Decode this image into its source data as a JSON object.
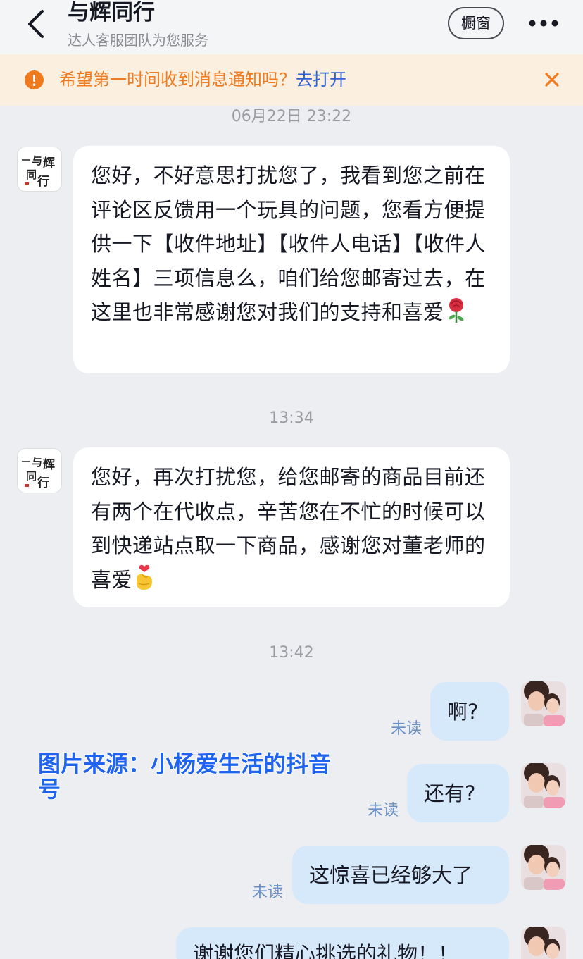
{
  "header": {
    "title": "与辉同行",
    "subtitle": "达人客服团队为您服务",
    "window_button": "橱窗"
  },
  "notice": {
    "text": "希望第一时间收到消息通知吗？",
    "link": "去打开"
  },
  "timestamps": [
    "06月22日 23:22",
    "13:34",
    "13:42"
  ],
  "brand_avatar_text": "与辉同行",
  "messages_in": [
    {
      "text": "您好，不好意思打扰您了，我看到您之前在评论区反馈用一个玩具的问题，您看方便提供一下【收件地址】【收件人电话】【收件人姓名】三项信息么，咱们给您邮寄过去，在这里也非常感谢您对我们的支持和喜爱",
      "emoji": "rose-icon"
    },
    {
      "text": "您好，再次打扰您，给您邮寄的商品目前还有两个在代收点，辛苦您在不忙的时候可以到快递站点取一下商品，感谢您对董老师的喜爱",
      "emoji": "finger-heart-icon"
    }
  ],
  "messages_out": [
    {
      "text": "啊?",
      "status": "未读"
    },
    {
      "text": "还有?",
      "status": "未读"
    },
    {
      "text": "这惊喜已经够大了",
      "status": "未读"
    },
    {
      "text": "谢谢您们精心挑选的礼物！！",
      "status": ""
    }
  ],
  "watermark": "图片来源：小杨爱生活的抖音号",
  "colors": {
    "accent_orange": "#f07a1e",
    "link_blue": "#2c60d8",
    "outgoing_bubble": "#d6e9fb",
    "unread_text": "#6a8fc4"
  }
}
